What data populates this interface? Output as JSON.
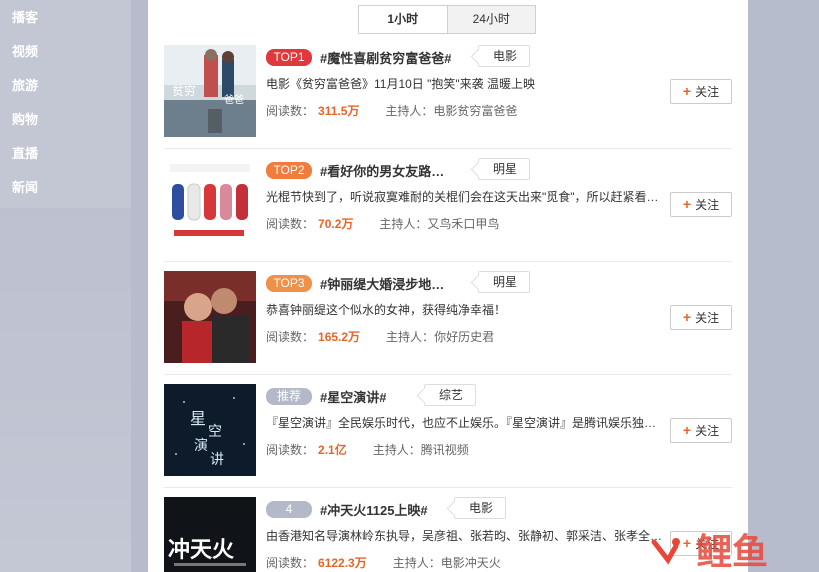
{
  "sidebar": {
    "items": [
      {
        "label": "播客"
      },
      {
        "label": "视频"
      },
      {
        "label": "旅游"
      },
      {
        "label": "购物"
      },
      {
        "label": "直播"
      },
      {
        "label": "新闻"
      }
    ]
  },
  "tabs": [
    {
      "label": "1小时"
    },
    {
      "label": "24小时"
    }
  ],
  "list": [
    {
      "rank": "TOP1",
      "rank_color": "#e0383c",
      "title": "#魔性喜剧贫穷富爸爸#",
      "category": "电影",
      "desc": "电影《贫穷富爸爸》11月10日 \"抱笑\"来袭 温暖上映",
      "read_label": "阅读数：",
      "read_count": "311.5万",
      "host_label": "主持人：",
      "host": "电影贫穷富爸爸",
      "follow_label": "关注"
    },
    {
      "rank": "TOP2",
      "rank_color": "#f07d3c",
      "title": "#看好你的男女友路…",
      "category": "明星",
      "desc": "光棍节快到了，听说寂寞难耐的关棍们会在这天出来\"觅食\"，所以赶紧看…",
      "read_label": "阅读数：",
      "read_count": "70.2万",
      "host_label": "主持人：",
      "host": "又鸟禾口甲鸟",
      "follow_label": "关注"
    },
    {
      "rank": "TOP3",
      "rank_color": "#f0914a",
      "title": "#钟丽缇大婚浸步地…",
      "category": "明星",
      "desc": "恭喜钟丽缇这个似水的女神，获得纯净幸福！",
      "read_label": "阅读数：",
      "read_count": "165.2万",
      "host_label": "主持人：",
      "host": "你好历史君",
      "follow_label": "关注"
    },
    {
      "rank": "推荐",
      "rank_color": "#b4b9c9",
      "title": "#星空演讲#",
      "category": "综艺",
      "desc": "『星空演讲』全民娱乐时代，也应不止娱乐。『星空演讲』是腾讯娱乐独…",
      "read_label": "阅读数：",
      "read_count": "2.1亿",
      "host_label": "主持人：",
      "host": "腾讯视频",
      "follow_label": "关注"
    },
    {
      "rank": "4",
      "rank_color": "#b4b9c9",
      "title": "#冲天火1125上映#",
      "category": "电影",
      "desc": "由香港知名导演林岭东执导，吴彦祖、张若昀、张静初、郭采洁、张孝全…",
      "read_label": "阅读数：",
      "read_count": "6122.3万",
      "host_label": "主持人：",
      "host": "电影冲天火",
      "follow_label": "关注"
    }
  ],
  "watermark": {
    "text": "鲤鱼"
  },
  "colors": {
    "accent": "#e8652a",
    "background": "#b7bccc"
  }
}
